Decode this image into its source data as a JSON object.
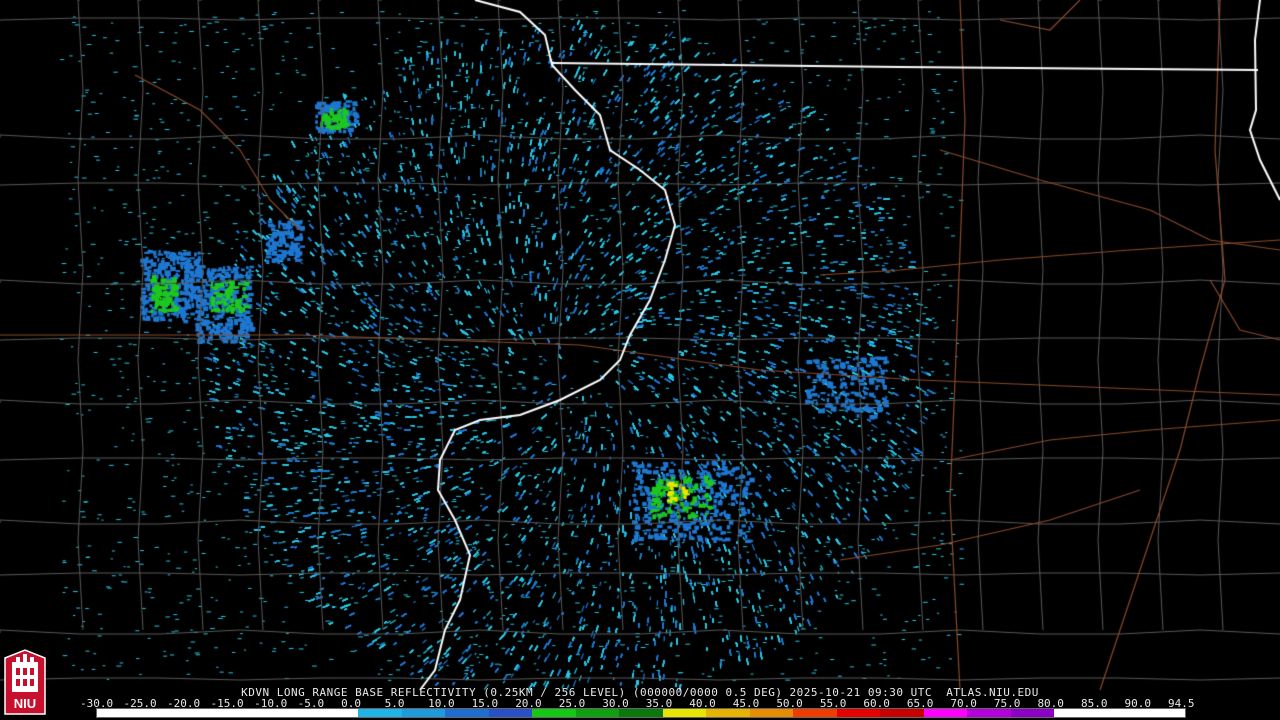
{
  "caption": "KDVN LONG RANGE BASE REFLECTIVITY (0.25KM / 256 LEVEL) (000000/0000 0.5 DEG) 2025-10-21 09:30 UTC  ATLAS.NIU.EDU",
  "scale_labels": [
    "-30.0",
    "-25.0",
    "-20.0",
    "-15.0",
    "-10.0",
    "-5.0",
    "0.0",
    "5.0",
    "10.0",
    "15.0",
    "20.0",
    "25.0",
    "30.0",
    "35.0",
    "40.0",
    "45.0",
    "50.0",
    "55.0",
    "60.0",
    "65.0",
    "70.0",
    "75.0",
    "80.0",
    "85.0",
    "90.0",
    "94.5"
  ],
  "scale_colors": [
    "#ffffff",
    "#ffffff",
    "#ffffff",
    "#ffffff",
    "#ffffff",
    "#ffffff",
    "#1eb4e6",
    "#1e9bdc",
    "#1e6ed2",
    "#2850c8",
    "#14c814",
    "#0ea00e",
    "#0a780a",
    "#e6e600",
    "#e6b400",
    "#e68c00",
    "#f03c00",
    "#e60000",
    "#c80000",
    "#ff00ff",
    "#b400dc",
    "#8c00c8",
    "#ffffff",
    "#ffffff",
    "#ffffff"
  ],
  "logo_text": "NIU",
  "map_colors": {
    "county_lines": "#5a5a5a",
    "highways": "#8b4a2a",
    "state_lines": "#ffffff",
    "echo_light": "#28c8e6",
    "echo_medium": "#1e78d2",
    "echo_green": "#1ec81e",
    "echo_yellow": "#e6e600"
  }
}
